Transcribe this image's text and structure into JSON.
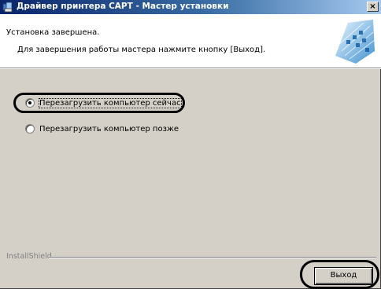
{
  "window": {
    "title": "Драйвер принтера CAPT - Мастер установки",
    "close_glyph": "×"
  },
  "header": {
    "title": "Установка завершена.",
    "description": "Для завершения работы мастера нажмите кнопку [Выход]."
  },
  "options": [
    {
      "label": "Перезагрузить компьютер сейчас",
      "checked": true,
      "access_key": "П"
    },
    {
      "label": "Перезагрузить компьютер позже",
      "checked": false,
      "access_key": "е"
    }
  ],
  "footer": {
    "brand": "InstallShield",
    "exit_label": "Выход",
    "exit_access_key": "В"
  },
  "colors": {
    "titlebar_start": "#0a246a",
    "titlebar_end": "#a6caf0",
    "dialog_bg": "#d4d0c8",
    "logo_blue": "#3a9ad9"
  }
}
